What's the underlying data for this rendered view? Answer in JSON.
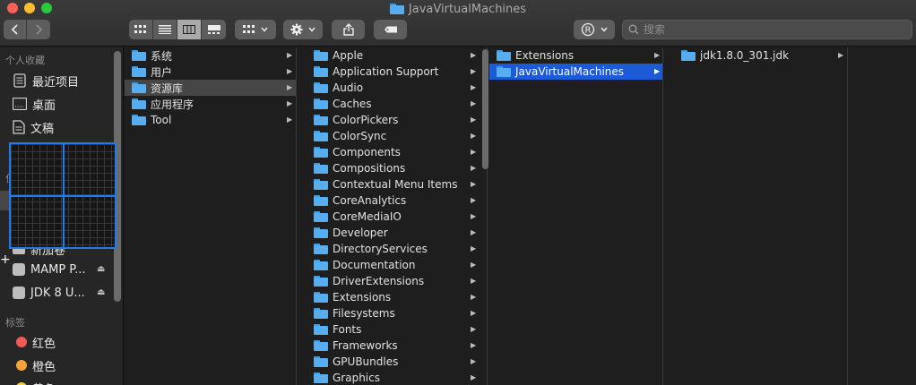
{
  "window": {
    "title": "JavaVirtualMachines"
  },
  "toolbar": {
    "search_placeholder": "搜索",
    "icons": [
      "chevron-left-icon",
      "chevron-right-icon",
      "grid-view-icon",
      "list-view-icon",
      "column-view-icon",
      "gallery-view-icon",
      "group-icon",
      "gear-icon",
      "share-icon",
      "tag-icon",
      "registered-icon"
    ]
  },
  "sidebar": {
    "favorites_header": "个人收藏",
    "favorites": [
      "最近项目",
      "桌面",
      "文稿"
    ],
    "partial_header": "位",
    "partial_item": "新加卷",
    "devices": [
      "MAMP P...",
      "JDK 8 U..."
    ],
    "tags_header": "标签",
    "tags": [
      {
        "label": "红色",
        "color": "#f05a57"
      },
      {
        "label": "橙色",
        "color": "#f6a23c"
      },
      {
        "label": "黄色",
        "color": "#f3d03c"
      }
    ]
  },
  "columns": [
    {
      "items": [
        "系统",
        "用户",
        "资源库",
        "应用程序",
        "Tool"
      ],
      "selected": "资源库"
    },
    {
      "items": [
        "Apple",
        "Application Support",
        "Audio",
        "Caches",
        "ColorPickers",
        "ColorSync",
        "Components",
        "Compositions",
        "Contextual Menu Items",
        "CoreAnalytics",
        "CoreMediaIO",
        "Developer",
        "DirectoryServices",
        "Documentation",
        "DriverExtensions",
        "Extensions",
        "Filesystems",
        "Fonts",
        "Frameworks",
        "GPUBundles",
        "Graphics"
      ]
    },
    {
      "items": [
        "Extensions",
        "JavaVirtualMachines"
      ],
      "selected": "JavaVirtualMachines"
    },
    {
      "items": [
        "jdk1.8.0_301.jdk"
      ]
    }
  ],
  "colors": {
    "accent": "#1b5bd6",
    "folder": "#56aef0",
    "overlay": "#1e7cf2"
  }
}
